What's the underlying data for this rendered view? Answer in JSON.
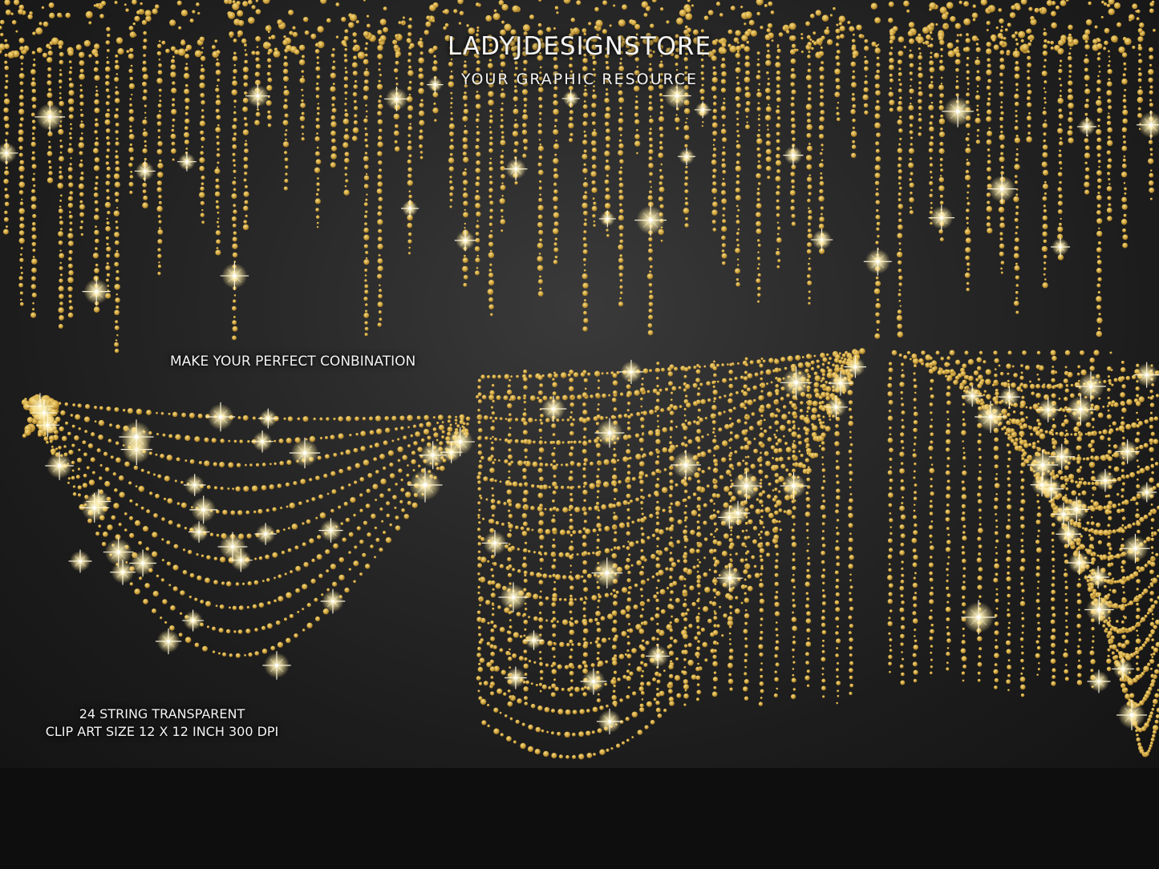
{
  "brand": {
    "name": "LADYJDESIGNSTORE",
    "tagline": "YOUR GRAPHIC RESOURCE"
  },
  "promo": {
    "headline": "MAKE YOUR PERFECT CONBINATION",
    "spec_lines": [
      "24 STRING TRANSPARENT",
      "CLIP ART SIZE 12 X 12 INCH 300 DPI"
    ]
  },
  "colors": {
    "background": "#2a2a2a",
    "gold": "#d9b54a",
    "gold_dark": "#a8822a",
    "sparkle": "#fff6d0",
    "footer": "#0e0e0e"
  }
}
